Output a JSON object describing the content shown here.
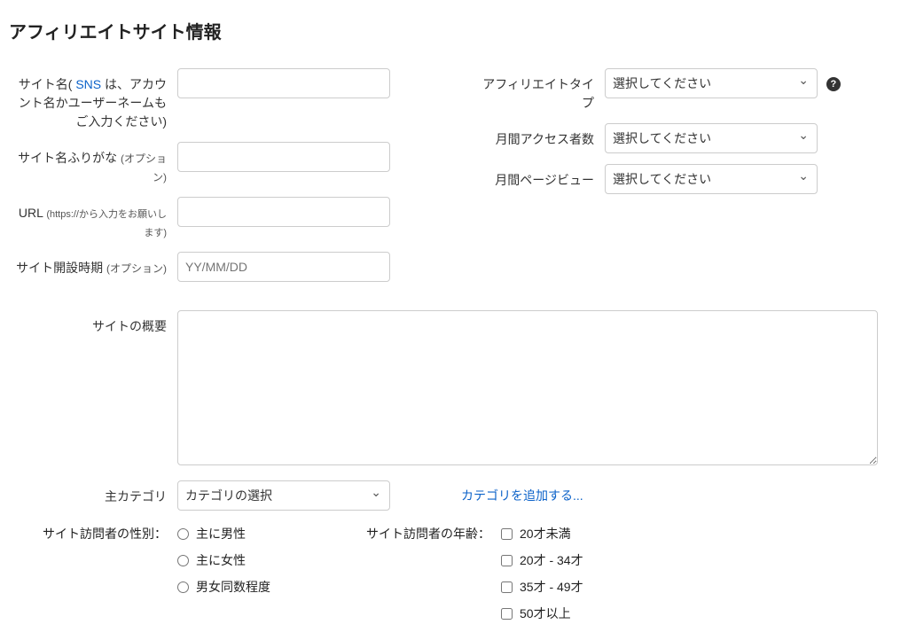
{
  "title": "アフィリエイトサイト情報",
  "left": {
    "siteName": {
      "label_pre": "サイト名( ",
      "label_link": "SNS",
      "label_post": " は、アカウント名かユーザーネームもご入力ください)",
      "value": ""
    },
    "siteNameFurigana": {
      "label_main": "サイト名ふりがな ",
      "label_opt": "(オプション)",
      "value": ""
    },
    "url": {
      "label_main": "URL ",
      "label_sub": "(https://から入力をお願いします)",
      "value": ""
    },
    "siteOpened": {
      "label_main": "サイト開設時期 ",
      "label_opt": "(オプション)",
      "placeholder": "YY/MM/DD",
      "value": ""
    }
  },
  "right": {
    "affiliateType": {
      "label": "アフィリエイトタイプ",
      "selected": "選択してください"
    },
    "monthlyAccess": {
      "label": "月間アクセス者数",
      "selected": "選択してください"
    },
    "monthlyPV": {
      "label": "月間ページビュー",
      "selected": "選択してください"
    }
  },
  "overview": {
    "label": "サイトの概要",
    "value": ""
  },
  "category": {
    "label": "主カテゴリ",
    "selected": "カテゴリの選択",
    "addLink": "カテゴリを追加する..."
  },
  "gender": {
    "label": "サイト訪問者の性別：",
    "options": [
      "主に男性",
      "主に女性",
      "男女同数程度"
    ]
  },
  "age": {
    "label": "サイト訪問者の年齢：",
    "options": [
      "20才未満",
      "20才 - 34才",
      "35才 - 49才",
      "50才以上"
    ]
  }
}
